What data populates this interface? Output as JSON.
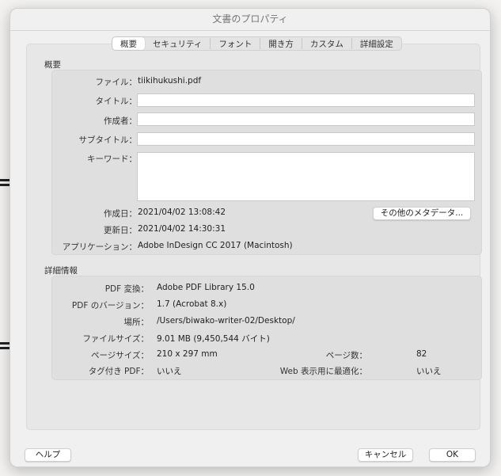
{
  "dialog": {
    "title": "文書のプロパティ"
  },
  "tabs": [
    {
      "label": "概要",
      "active": true
    },
    {
      "label": "セキュリティ"
    },
    {
      "label": "フォント"
    },
    {
      "label": "開き方"
    },
    {
      "label": "カスタム"
    },
    {
      "label": "詳細設定"
    }
  ],
  "summary": {
    "section_label": "概要",
    "file_label": "ファイル：",
    "file_value": "tiikihukushi.pdf",
    "title_label": "タイトル：",
    "title_value": "",
    "author_label": "作成者：",
    "author_value": "",
    "subject_label": "サブタイトル：",
    "subject_value": "",
    "keywords_label": "キーワード：",
    "keywords_value": "",
    "created_label": "作成日：",
    "created_value": "2021/04/02 13:08:42",
    "modified_label": "更新日：",
    "modified_value": "2021/04/02 14:30:31",
    "application_label": "アプリケーション：",
    "application_value": "Adobe InDesign CC 2017 (Macintosh)",
    "metadata_button": "その他のメタデータ..."
  },
  "details": {
    "section_label": "詳細情報",
    "producer_label": "PDF 変換：",
    "producer_value": "Adobe PDF Library 15.0",
    "version_label": "PDF のバージョン：",
    "version_value": "1.7 (Acrobat 8.x)",
    "location_label": "場所：",
    "location_value": "/Users/biwako-writer-02/Desktop/",
    "filesize_label": "ファイルサイズ：",
    "filesize_value": "9.01 MB (9,450,544 バイト)",
    "pagesize_label": "ページサイズ：",
    "pagesize_value": "210 x 297 mm",
    "pagecount_label": "ページ数：",
    "pagecount_value": "82",
    "tagged_label": "タグ付き PDF：",
    "tagged_value": "いいえ",
    "fastweb_label": "Web 表示用に最適化：",
    "fastweb_value": "いいえ"
  },
  "buttons": {
    "help": "ヘルプ",
    "cancel": "キャンセル",
    "ok": "OK"
  }
}
